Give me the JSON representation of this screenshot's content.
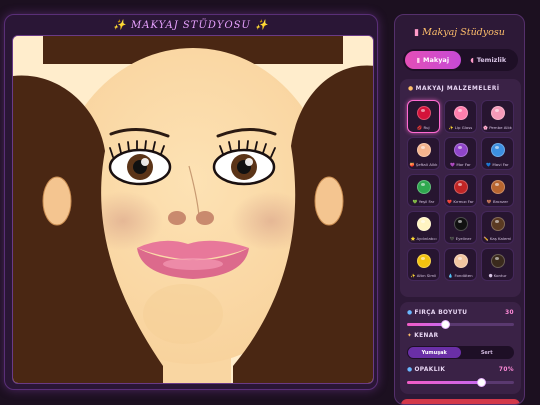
{
  "stage": {
    "title": "✨ MAKYAJ STÜDYOSU ✨"
  },
  "panel": {
    "title": "Makyaj Stüdyosu",
    "tabs": [
      {
        "label": "Makyaj",
        "icon": "lipstick-icon",
        "active": true
      },
      {
        "label": "Temizlik",
        "icon": "soap-icon",
        "active": false
      }
    ]
  },
  "materials": {
    "heading": "MAKYAJ MALZEMELERİ",
    "items": [
      {
        "label": "💋 Ruj",
        "color": "#d4123a",
        "active": true
      },
      {
        "label": "✨ Lip Gloss",
        "color": "#ff7fae"
      },
      {
        "label": "🌸 Pembe Allık",
        "color": "#f59ab9"
      },
      {
        "label": "🍑 Şeftali Allık",
        "color": "#f5b48e"
      },
      {
        "label": "💜 Mor Far",
        "color": "#8f45c9"
      },
      {
        "label": "💙 Mavi Far",
        "color": "#3c8fe0"
      },
      {
        "label": "💚 Yeşil Far",
        "color": "#2fa84f"
      },
      {
        "label": "❤️ Kırmızı Far",
        "color": "#c02525"
      },
      {
        "label": "🤎 Bronzer",
        "color": "#b8652f"
      },
      {
        "label": "⭐ Aydınlatıcı",
        "color": "#fff4c2"
      },
      {
        "label": "🖤 Eyeliner",
        "color": "#111111"
      },
      {
        "label": "✏️ Kaş Kalemi",
        "color": "#5a3a22"
      },
      {
        "label": "✨ Altın Simli",
        "color": "#f3c30f"
      },
      {
        "label": "💧 Fondöten",
        "color": "#f1c6a0"
      },
      {
        "label": "🌑 Kontur",
        "color": "#3a2a1c"
      }
    ]
  },
  "controls": {
    "brush_label": "FIRÇA BOYUTU",
    "brush_value": "30",
    "brush_fraction": 0.36,
    "edge_label": "KENAR",
    "edge_options": [
      {
        "label": "Yumuşak",
        "active": true
      },
      {
        "label": "Sert",
        "active": false
      }
    ],
    "opacity_label": "OPAKLIK",
    "opacity_value": "70%",
    "opacity_fraction": 0.7
  },
  "colors": {
    "accent": "#e34fb7",
    "hair": "#4a2713",
    "skin": "#fce1b0"
  }
}
